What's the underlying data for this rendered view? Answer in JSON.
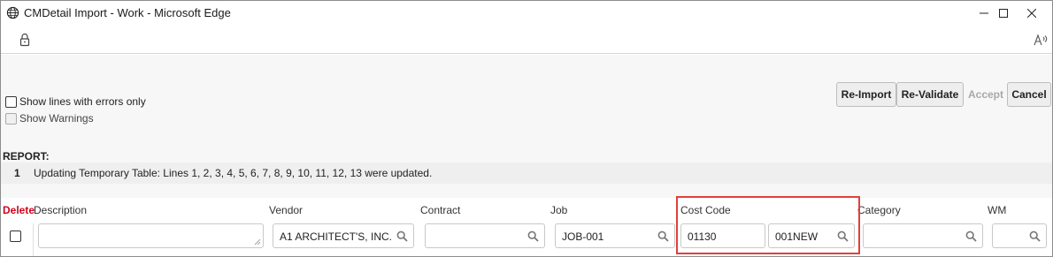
{
  "window": {
    "title": "CMDetail Import - Work - Microsoft Edge",
    "icon": "globe-icon"
  },
  "browser": {
    "lock_icon": "lock-icon",
    "read_aloud_icon": "read-aloud-icon"
  },
  "options": {
    "show_errors_label": "Show lines with errors only",
    "show_errors_checked": false,
    "show_warnings_label": "Show Warnings",
    "show_warnings_checked": false,
    "show_warnings_disabled": true
  },
  "actions": {
    "reimport_label": "Re-Import",
    "revalidate_label": "Re-Validate",
    "accept_label": "Accept",
    "accept_disabled": true,
    "cancel_label": "Cancel"
  },
  "report": {
    "label": "REPORT:",
    "lines": [
      {
        "num": "1",
        "message": "Updating Temporary Table: Lines 1, 2, 3, 4, 5, 6, 7, 8, 9, 10, 11, 12, 13 were updated."
      }
    ]
  },
  "grid": {
    "columns": {
      "delete": "Delete",
      "description": "Description",
      "vendor": "Vendor",
      "contract": "Contract",
      "job": "Job",
      "cost_code": "Cost Code",
      "category": "Category",
      "wm": "WM"
    },
    "row": {
      "delete_checked": false,
      "description": "",
      "vendor": "A1 ARCHITECT'S, INC.",
      "contract": "",
      "job": "JOB-001",
      "cost_code": "01130",
      "cost_code_2": "001NEW",
      "category": "",
      "wm": ""
    }
  },
  "colors": {
    "delete_header": "#d0021b",
    "highlight_box": "#e0403c",
    "disabled_text": "#a8a8a8"
  }
}
